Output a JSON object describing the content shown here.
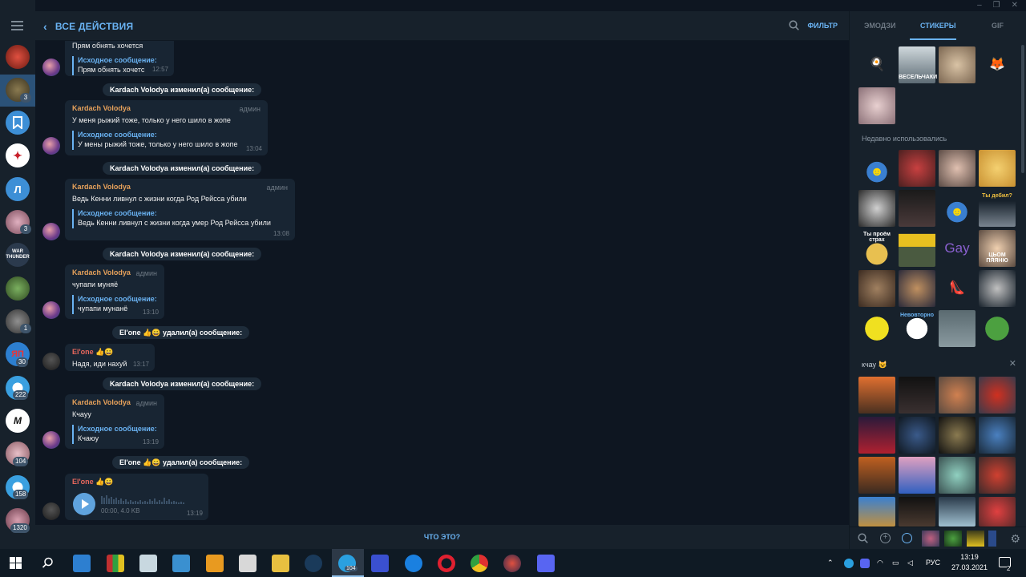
{
  "window": {
    "controls": [
      "–",
      "❐",
      "✕"
    ]
  },
  "header": {
    "back_label": "ВСЕ ДЕЙСТВИЯ",
    "filter_label": "ФИЛЬТР"
  },
  "log": {
    "msg0": {
      "text": "Прям обнять хочется",
      "reply_title": "Исходное сообщение:",
      "reply_text": "Прям обнять хочетс",
      "time": "12:57"
    },
    "svc1": "Kardach Volodya изменил(а) сообщение:",
    "msg1": {
      "author": "Kardach Volodya",
      "role": "админ",
      "text": "У меня рыжий тоже, только у него шило в жопе",
      "reply_title": "Исходное сообщение:",
      "reply_text": "У мены рыжий тоже, только у него шило в жопе",
      "time": "13:04"
    },
    "svc2": "Kardach Volodya изменил(а) сообщение:",
    "msg2": {
      "author": "Kardach Volodya",
      "role": "админ",
      "text": "Ведь Кенни ливнул с жизни когда  Род Рейсса убили",
      "reply_title": "Исходное сообщение:",
      "reply_text": "Ведь Кенни ливнул с жизни когда умер Род Рейсса убили",
      "time": "13:08"
    },
    "svc3": "Kardach Volodya изменил(а) сообщение:",
    "msg3": {
      "author": "Kardach Volodya",
      "role": "админ",
      "text": "чупапи муняё",
      "reply_title": "Исходное сообщение:",
      "reply_text": "чупапи мунанё",
      "time": "13:10"
    },
    "svc4": "El'one 👍😀 удалил(а) сообщение:",
    "msg4": {
      "author": "El'one 👍😀",
      "text": "Надя, иди нахуй",
      "time": "13:17"
    },
    "svc5": "Kardach Volodya изменил(а) сообщение:",
    "msg5": {
      "author": "Kardach Volodya",
      "role": "админ",
      "text": "Кчауу",
      "reply_title": "Исходное сообщение:",
      "reply_text": "Кчаюу",
      "time": "13:19"
    },
    "svc6": "El'one 👍😀 удалил(а) сообщение:",
    "msg6": {
      "author": "El'one 👍😀",
      "voice_meta": "00:00, 4.0 KB",
      "time": "13:19"
    }
  },
  "bottom": {
    "label": "ЧТО ЭТО?"
  },
  "chats": {
    "b1": "3",
    "l_letter": "Л",
    "b2": "3",
    "wt": "WAR THUNDER",
    "b3": "1",
    "b4": "30",
    "b5": "222",
    "b6": "104",
    "b7": "158",
    "b8": "1320"
  },
  "panel": {
    "tabs": [
      "ЭМОДЗИ",
      "СТИКЕРЫ",
      "GIF"
    ],
    "recent_title": "Недавно использовались",
    "pack_title": "кчау 😺",
    "sticker_texts": {
      "a": "ВЕСЕЛЬЧАКИ",
      "b": "Ты дебил?",
      "c": "Ты проём страх",
      "d": "Gay",
      "e": "ЦЬОМ ПЯЯНЮ",
      "f": "Невовторно"
    }
  },
  "taskbar": {
    "lang": "РУС",
    "time": "13:19",
    "date": "27.03.2021",
    "notif": "2",
    "tg_badge": "104"
  },
  "colors": {
    "bg": "#0e1621",
    "panel": "#17212b",
    "accent": "#6ab3f3",
    "name_orange": "#e6a15b",
    "name_red": "#e9685d",
    "active": "#2b5278"
  }
}
